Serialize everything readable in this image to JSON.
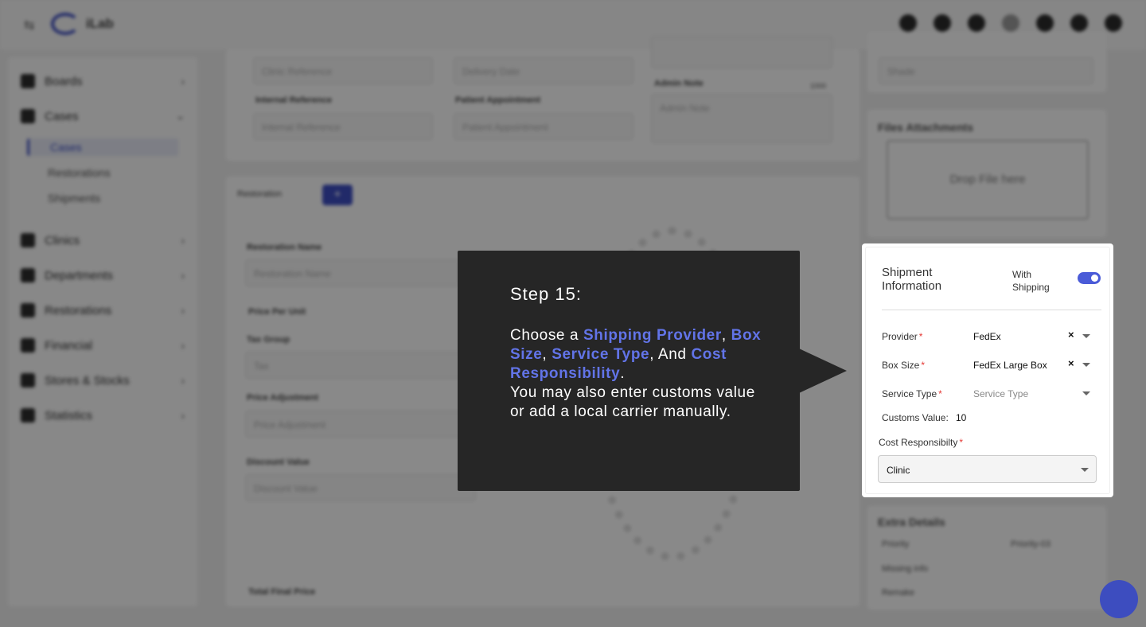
{
  "app": {
    "name": "iLab"
  },
  "sidebar": {
    "items": [
      {
        "label": "Boards"
      },
      {
        "label": "Cases"
      },
      {
        "label": "Clinics"
      },
      {
        "label": "Departments"
      },
      {
        "label": "Restorations"
      },
      {
        "label": "Financial"
      },
      {
        "label": "Stores & Stocks"
      },
      {
        "label": "Statistics"
      }
    ],
    "cases_sub": [
      {
        "label": "Cases"
      },
      {
        "label": "Restorations"
      },
      {
        "label": "Shipments"
      }
    ]
  },
  "form": {
    "clinic_reference_placeholder": "Clinic Reference",
    "delivery_date_placeholder": "Delivery Date",
    "internal_reference_label": "Internal Reference",
    "internal_reference_placeholder": "Internal Reference",
    "patient_appointment_label": "Patient Appointment",
    "patient_appointment_placeholder": "Patient Appointment",
    "admin_note_label": "Admin Note",
    "admin_note_count": "1000",
    "admin_note_placeholder": "Admin Note",
    "shade_placeholder": "Shade",
    "restoration_tab": "Restoration",
    "add_tab": "+",
    "restoration_name_label": "Restoration Name",
    "restoration_name_placeholder": "Restoration Name",
    "price_per_unit_label": "Price Per Unit",
    "tax_group_label": "Tax Group",
    "tax_placeholder": "Tax",
    "price_adjustment_label": "Price Adjustment",
    "price_adjustment_placeholder": "Price Adjustment",
    "discount_value_label": "Discount Value",
    "discount_value_placeholder": "Discount Value",
    "total_final_price_label": "Total Final Price"
  },
  "files": {
    "title": "Files Attachments",
    "drop_text": "Drop File here"
  },
  "extra": {
    "title": "Extra Details",
    "priority_label": "Priority",
    "priority_value": "Priority-03",
    "missing_info_label": "Missing info",
    "remake_label": "Remake"
  },
  "shipment": {
    "title": "Shipment Information",
    "with_shipping_label": "With Shipping",
    "with_shipping_on": true,
    "provider_label": "Provider",
    "provider_value": "FedEx",
    "box_size_label": "Box Size",
    "box_size_value": "FedEx Large Box",
    "service_type_label": "Service Type",
    "service_type_placeholder": "Service Type",
    "customs_value_label": "Customs Value:",
    "customs_value": "10",
    "cost_responsibility_label": "Cost Responsibilty",
    "cost_responsibility_value": "Clinic",
    "required_mark": "*",
    "clear_mark": "×"
  },
  "tooltip": {
    "step": "Step 15:",
    "intro": "Choose a ",
    "hl1": "Shipping Provider",
    "sep1": ",",
    "hl2": "Box Size",
    "sep2": ", ",
    "hl3": "Service Type",
    "sep3": ", And",
    "hl4": "Cost Responsibility",
    "sep4": ".",
    "outro": "You may also enter customs value or add a local carrier manually."
  },
  "colors": {
    "accent": "#3d4dbf",
    "highlight": "#6274e8",
    "tooltip_bg": "#262626",
    "required": "#e53935"
  },
  "icons": [
    "menu-toggle-icon",
    "logo-icon",
    "help-icon",
    "chat-icon",
    "status-icon",
    "link-icon",
    "settings-icon",
    "bell-icon",
    "logout-icon",
    "support-chat-icon"
  ]
}
